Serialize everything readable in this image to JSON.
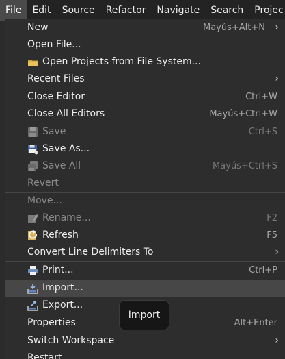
{
  "menubar": {
    "items": [
      "File",
      "Edit",
      "Source",
      "Refactor",
      "Navigate",
      "Search",
      "Projec"
    ]
  },
  "menu": {
    "new": {
      "label": "New",
      "shortcut": "Mayús+Alt+N"
    },
    "open_file": {
      "label": "Open File..."
    },
    "open_projects": {
      "label": "Open Projects from File System..."
    },
    "recent_files": {
      "label": "Recent Files"
    },
    "close_editor": {
      "label": "Close Editor",
      "shortcut": "Ctrl+W"
    },
    "close_all": {
      "label": "Close All Editors",
      "shortcut": "Mayús+Ctrl+W"
    },
    "save": {
      "label": "Save",
      "shortcut": "Ctrl+S"
    },
    "save_as": {
      "label": "Save As..."
    },
    "save_all": {
      "label": "Save All",
      "shortcut": "Mayús+Ctrl+S"
    },
    "revert": {
      "label": "Revert"
    },
    "move": {
      "label": "Move..."
    },
    "rename": {
      "label": "Rename...",
      "shortcut": "F2"
    },
    "refresh": {
      "label": "Refresh",
      "shortcut": "F5"
    },
    "convert": {
      "label": "Convert Line Delimiters To"
    },
    "print": {
      "label": "Print...",
      "shortcut": "Ctrl+P"
    },
    "import": {
      "label": "Import..."
    },
    "export": {
      "label": "Export..."
    },
    "properties": {
      "label": "Properties",
      "shortcut": "Alt+Enter"
    },
    "switch_ws": {
      "label": "Switch Workspace"
    },
    "restart": {
      "label": "Restart"
    }
  },
  "tooltip": {
    "text": "Import"
  },
  "colors": {
    "menu_bg": "#2d2d2d",
    "highlight": "#474747",
    "disabled_text": "#8a8a8a"
  }
}
